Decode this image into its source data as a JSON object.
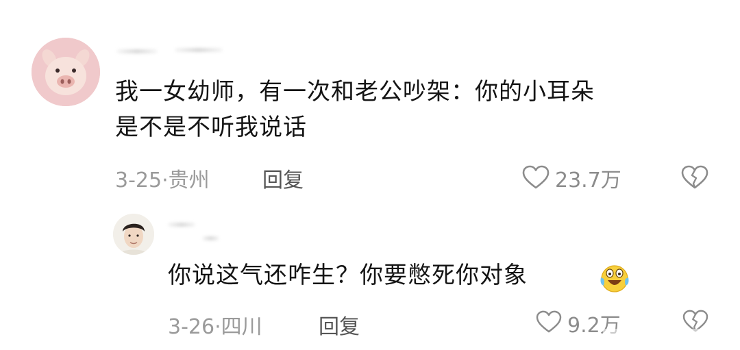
{
  "comments": [
    {
      "text_lines": [
        "我一女幼师，有一次和老公吵架：你的小耳朵",
        "是不是不听我说话"
      ],
      "meta": "3-25·贵州",
      "reply_label": "回复",
      "likes": "23.7万",
      "avatar_icon": "pig-avatar"
    },
    {
      "text": "你说这气还咋生？你要憋死你对象",
      "meta": "3-26·四川",
      "reply_label": "回复",
      "likes": "9.2万",
      "avatar_icon": "man-avatar",
      "emoji": "laughing-crying-emoji"
    }
  ],
  "colors": {
    "text": "#141414",
    "meta": "#9a9a9a",
    "reply": "#555555",
    "counts": "#8c8c8c",
    "pig_bg": "#f0c9cb"
  }
}
